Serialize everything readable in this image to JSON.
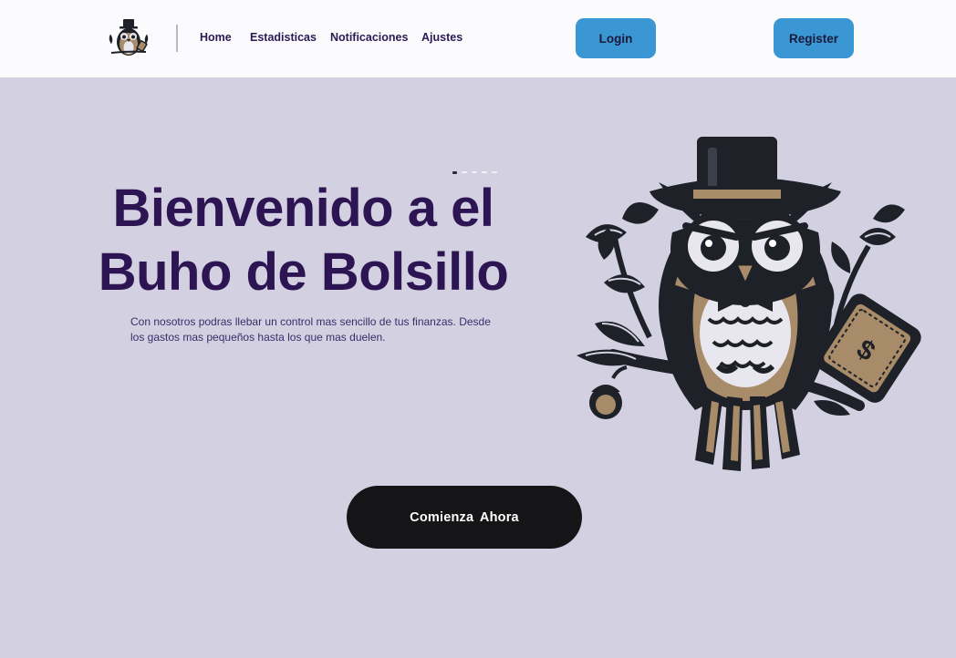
{
  "nav": {
    "logo_icon": "owl-logo-icon",
    "links": [
      "Home",
      "Estadisticas",
      "Notificaciones",
      "Ajustes"
    ],
    "login_label": "Login",
    "register_label": "Register"
  },
  "hero": {
    "title_line1": "Bienvenido a el",
    "title_line2": "Buho de Bolsillo",
    "description": "Con nosotros podras llebar un control mas sencillo de tus finanzas. Desde los gastos mas pequeños hasta los que mas duelen.",
    "illustration_icon": "owl-top-hat-icon",
    "money_symbol": "$",
    "carousel_active_index": 0,
    "carousel_count": 5
  },
  "cta": {
    "label": "Comienza  Ahora"
  },
  "colors": {
    "page_bg": "#d3d1e1",
    "nav_bg": "#fbfbfd",
    "title": "#2d1554",
    "auth_button": "#3a97d4",
    "cta_button": "#151517",
    "owl_dark": "#1e2128",
    "owl_tan": "#a88b68"
  }
}
